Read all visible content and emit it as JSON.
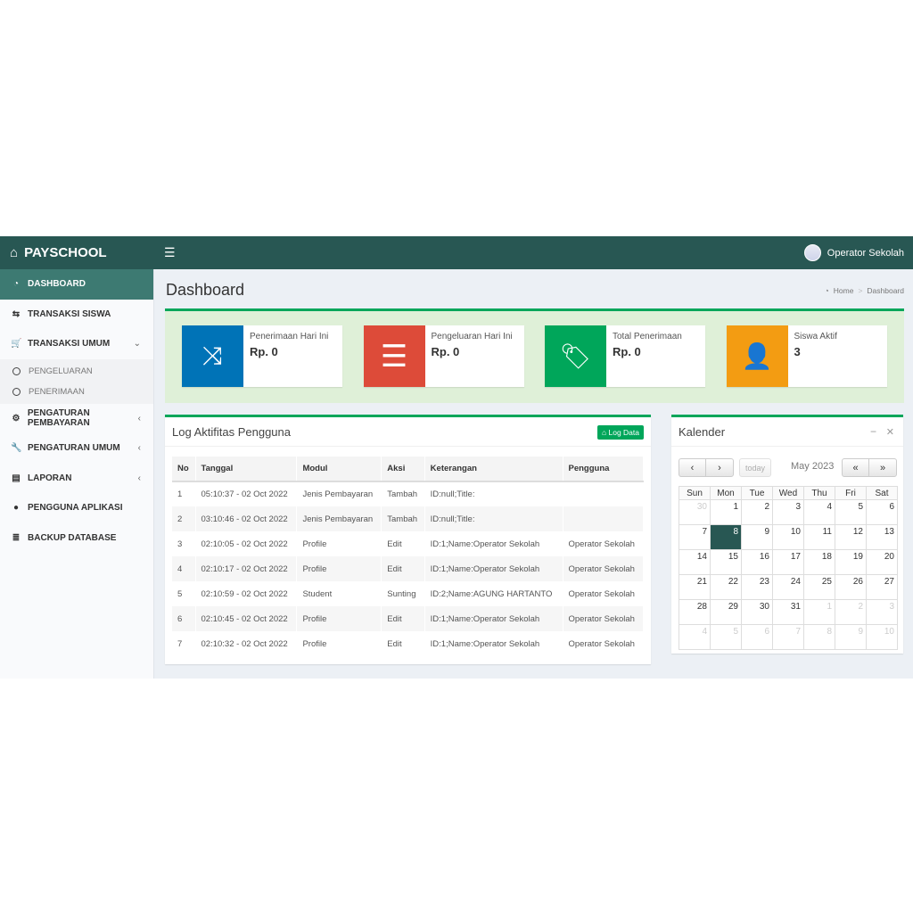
{
  "app": {
    "brand": "PAYSCHOOL",
    "user": "Operator Sekolah"
  },
  "sidebar": {
    "items": [
      {
        "label": "DASHBOARD",
        "icon": "dashboard-icon",
        "glyph": "◔",
        "active": true
      },
      {
        "label": "TRANSAKSI SISWA",
        "icon": "transfer-icon",
        "glyph": "⇆"
      },
      {
        "label": "TRANSAKSI UMUM",
        "icon": "cart-icon",
        "glyph": "🛒",
        "caret": "⌄",
        "sub": [
          "PENGELUARAN",
          "PENERIMAAN"
        ]
      },
      {
        "label": "PENGATURAN PEMBAYARAN",
        "icon": "gear-icon",
        "glyph": "⚙",
        "caret": "‹"
      },
      {
        "label": "PENGATURAN UMUM",
        "icon": "wrench-icon",
        "glyph": "🔧",
        "caret": "‹"
      },
      {
        "label": "LAPORAN",
        "icon": "file-icon",
        "glyph": "▤",
        "caret": "‹"
      },
      {
        "label": "PENGGUNA APLIKASI",
        "icon": "user-icon",
        "glyph": "●"
      },
      {
        "label": "BACKUP DATABASE",
        "icon": "database-icon",
        "glyph": "≣"
      }
    ]
  },
  "page": {
    "title": "Dashboard",
    "breadcrumb": [
      "Home",
      "Dashboard"
    ]
  },
  "info_boxes": [
    {
      "label": "Penerimaan Hari Ini",
      "value": "Rp. 0",
      "color": "#0073b7",
      "icon": "shuffle-icon"
    },
    {
      "label": "Pengeluaran Hari Ini",
      "value": "Rp. 0",
      "color": "#dd4b39",
      "icon": "bars-icon"
    },
    {
      "label": "Total Penerimaan",
      "value": "Rp. 0",
      "color": "#00a65a",
      "icon": "tags-icon"
    },
    {
      "label": "Siswa Aktif",
      "value": "3",
      "color": "#f39c12",
      "icon": "user-icon"
    }
  ],
  "log": {
    "title": "Log Aktifitas Pengguna",
    "button": "Log Data",
    "columns": [
      "No",
      "Tanggal",
      "Modul",
      "Aksi",
      "Keterangan",
      "Pengguna"
    ],
    "rows": [
      [
        "1",
        "05:10:37 - 02 Oct 2022",
        "Jenis Pembayaran",
        "Tambah",
        "ID:null;Title:",
        ""
      ],
      [
        "2",
        "03:10:46 - 02 Oct 2022",
        "Jenis Pembayaran",
        "Tambah",
        "ID:null;Title:",
        ""
      ],
      [
        "3",
        "02:10:05 - 02 Oct 2022",
        "Profile",
        "Edit",
        "ID:1;Name:Operator Sekolah",
        "Operator Sekolah"
      ],
      [
        "4",
        "02:10:17 - 02 Oct 2022",
        "Profile",
        "Edit",
        "ID:1;Name:Operator Sekolah",
        "Operator Sekolah"
      ],
      [
        "5",
        "02:10:59 - 02 Oct 2022",
        "Student",
        "Sunting",
        "ID:2;Name:AGUNG HARTANTO",
        "Operator Sekolah"
      ],
      [
        "6",
        "02:10:45 - 02 Oct 2022",
        "Profile",
        "Edit",
        "ID:1;Name:Operator Sekolah",
        "Operator Sekolah"
      ],
      [
        "7",
        "02:10:32 - 02 Oct 2022",
        "Profile",
        "Edit",
        "ID:1;Name:Operator Sekolah",
        "Operator Sekolah"
      ]
    ]
  },
  "calendar": {
    "title": "Kalender",
    "today_label": "today",
    "month": "May 2023",
    "weekdays": [
      "Sun",
      "Mon",
      "Tue",
      "Wed",
      "Thu",
      "Fri",
      "Sat"
    ],
    "weeks": [
      [
        "30",
        "1",
        "2",
        "3",
        "4",
        "5",
        "6"
      ],
      [
        "7",
        "8",
        "9",
        "10",
        "11",
        "12",
        "13"
      ],
      [
        "14",
        "15",
        "16",
        "17",
        "18",
        "19",
        "20"
      ],
      [
        "21",
        "22",
        "23",
        "24",
        "25",
        "26",
        "27"
      ],
      [
        "28",
        "29",
        "30",
        "31",
        "1",
        "2",
        "3"
      ],
      [
        "4",
        "5",
        "6",
        "7",
        "8",
        "9",
        "10"
      ]
    ],
    "today": "8"
  }
}
